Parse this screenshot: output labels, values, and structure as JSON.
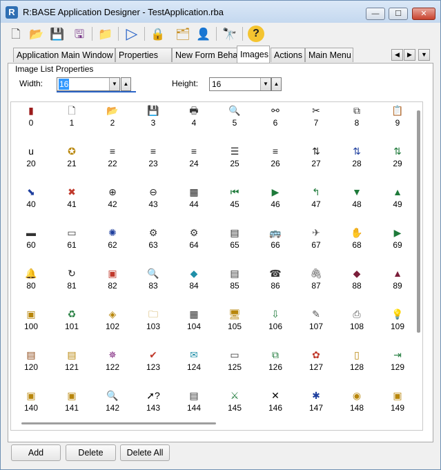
{
  "window": {
    "title": "R:BASE Application Designer - TestApplication.rba"
  },
  "window_controls": {
    "minimize": "—",
    "maximize": "☐",
    "close": "✕"
  },
  "toolbar": {
    "buttons": [
      {
        "name": "new-icon",
        "glyph": "🗋"
      },
      {
        "name": "open-folder-icon",
        "glyph": "📂"
      },
      {
        "name": "save-icon",
        "glyph": "💾"
      },
      {
        "name": "save-as-icon",
        "glyph": "🖫"
      },
      {
        "name": "folder-up-icon",
        "glyph": "📁"
      },
      {
        "name": "run-icon",
        "glyph": "▷"
      },
      {
        "name": "lock-icon",
        "glyph": "🔒"
      },
      {
        "name": "tree-icon",
        "glyph": "🗂"
      },
      {
        "name": "user-icon",
        "glyph": "👤"
      },
      {
        "name": "binoculars-icon",
        "glyph": "🔭"
      },
      {
        "name": "help-icon",
        "glyph": "?"
      }
    ]
  },
  "tabs": [
    {
      "label": "Application Main Window"
    },
    {
      "label": "Properties"
    },
    {
      "label": "New Form Behavior"
    },
    {
      "label": "Images"
    },
    {
      "label": "Actions"
    },
    {
      "label": "Main Menu"
    }
  ],
  "tab_scroll": {
    "left": "◀",
    "right": "▶",
    "menu": "▼"
  },
  "image_list_properties": {
    "title": "Image List Properties",
    "width_label": "Width:",
    "width_value": "16",
    "height_label": "Height:",
    "height_value": "16",
    "drop_glyph": "▼",
    "spin_glyph": "▲"
  },
  "images": [
    {
      "id": "0",
      "glyph": "▮",
      "color": "#9b1b1b"
    },
    {
      "id": "1",
      "glyph": "🗋",
      "color": "#333333"
    },
    {
      "id": "2",
      "glyph": "📂",
      "color": "#b8860b"
    },
    {
      "id": "3",
      "glyph": "💾",
      "color": "#333333"
    },
    {
      "id": "4",
      "glyph": "🖶",
      "color": "#333333"
    },
    {
      "id": "5",
      "glyph": "🔍",
      "color": "#333333"
    },
    {
      "id": "6",
      "glyph": "⚯",
      "color": "#222222"
    },
    {
      "id": "7",
      "glyph": "✂",
      "color": "#222222"
    },
    {
      "id": "8",
      "glyph": "⧉",
      "color": "#333333"
    },
    {
      "id": "9",
      "glyph": "📋",
      "color": "#333333"
    },
    {
      "id": "20",
      "glyph": "u",
      "color": "#000000"
    },
    {
      "id": "21",
      "glyph": "✪",
      "color": "#b8860b"
    },
    {
      "id": "22",
      "glyph": "≡",
      "color": "#222222"
    },
    {
      "id": "23",
      "glyph": "≡",
      "color": "#222222"
    },
    {
      "id": "24",
      "glyph": "≡",
      "color": "#222222"
    },
    {
      "id": "25",
      "glyph": "☰",
      "color": "#222222"
    },
    {
      "id": "26",
      "glyph": "≡",
      "color": "#222222"
    },
    {
      "id": "27",
      "glyph": "⇅",
      "color": "#222222"
    },
    {
      "id": "28",
      "glyph": "⇅",
      "color": "#1f3f9e"
    },
    {
      "id": "29",
      "glyph": "⇅",
      "color": "#1e7a3a"
    },
    {
      "id": "40",
      "glyph": "⬊",
      "color": "#1f3f9e"
    },
    {
      "id": "41",
      "glyph": "✖",
      "color": "#c0392b"
    },
    {
      "id": "42",
      "glyph": "⊕",
      "color": "#222222"
    },
    {
      "id": "43",
      "glyph": "⊖",
      "color": "#222222"
    },
    {
      "id": "44",
      "glyph": "▦",
      "color": "#222222"
    },
    {
      "id": "45",
      "glyph": "⏮",
      "color": "#1e7a3a"
    },
    {
      "id": "46",
      "glyph": "▶",
      "color": "#1e7a3a"
    },
    {
      "id": "47",
      "glyph": "↰",
      "color": "#1e7a3a"
    },
    {
      "id": "48",
      "glyph": "▼",
      "color": "#1e7a3a"
    },
    {
      "id": "49",
      "glyph": "▲",
      "color": "#1e7a3a"
    },
    {
      "id": "60",
      "glyph": "▬",
      "color": "#333333"
    },
    {
      "id": "61",
      "glyph": "▭",
      "color": "#333333"
    },
    {
      "id": "62",
      "glyph": "✺",
      "color": "#1f3f9e"
    },
    {
      "id": "63",
      "glyph": "⚙",
      "color": "#333333"
    },
    {
      "id": "64",
      "glyph": "⚙",
      "color": "#333333"
    },
    {
      "id": "65",
      "glyph": "▤",
      "color": "#222222"
    },
    {
      "id": "66",
      "glyph": "🚌",
      "color": "#1e7a3a"
    },
    {
      "id": "67",
      "glyph": "✈",
      "color": "#555555"
    },
    {
      "id": "68",
      "glyph": "✋",
      "color": "#555555"
    },
    {
      "id": "69",
      "glyph": "▶",
      "color": "#1e7a3a"
    },
    {
      "id": "80",
      "glyph": "🔔",
      "color": "#b8860b"
    },
    {
      "id": "81",
      "glyph": "↻",
      "color": "#222222"
    },
    {
      "id": "82",
      "glyph": "▣",
      "color": "#c0392b"
    },
    {
      "id": "83",
      "glyph": "🔍",
      "color": "#1f6fa8"
    },
    {
      "id": "84",
      "glyph": "◆",
      "color": "#1f8fa8"
    },
    {
      "id": "85",
      "glyph": "▤",
      "color": "#333333"
    },
    {
      "id": "86",
      "glyph": "☎",
      "color": "#333333"
    },
    {
      "id": "87",
      "glyph": "🖇",
      "color": "#555555"
    },
    {
      "id": "88",
      "glyph": "◆",
      "color": "#7b1e3a"
    },
    {
      "id": "89",
      "glyph": "▲",
      "color": "#7b1e3a"
    },
    {
      "id": "100",
      "glyph": "▣",
      "color": "#b8860b"
    },
    {
      "id": "101",
      "glyph": "♻",
      "color": "#1e7a3a"
    },
    {
      "id": "102",
      "glyph": "◈",
      "color": "#b8860b"
    },
    {
      "id": "103",
      "glyph": "🗀",
      "color": "#b8860b"
    },
    {
      "id": "104",
      "glyph": "▦",
      "color": "#333333"
    },
    {
      "id": "105",
      "glyph": "🖥",
      "color": "#b8860b"
    },
    {
      "id": "106",
      "glyph": "⇩",
      "color": "#1e7a3a"
    },
    {
      "id": "107",
      "glyph": "✎",
      "color": "#555555"
    },
    {
      "id": "108",
      "glyph": "⎙",
      "color": "#555555"
    },
    {
      "id": "109",
      "glyph": "💡",
      "color": "#b8860b"
    },
    {
      "id": "120",
      "glyph": "▤",
      "color": "#8b4513"
    },
    {
      "id": "121",
      "glyph": "▤",
      "color": "#b8860b"
    },
    {
      "id": "122",
      "glyph": "✵",
      "color": "#7b1e7a"
    },
    {
      "id": "123",
      "glyph": "✔",
      "color": "#c0392b"
    },
    {
      "id": "124",
      "glyph": "✉",
      "color": "#1f8fa8"
    },
    {
      "id": "125",
      "glyph": "▭",
      "color": "#333333"
    },
    {
      "id": "126",
      "glyph": "⧉",
      "color": "#1e7a3a"
    },
    {
      "id": "127",
      "glyph": "✿",
      "color": "#c0392b"
    },
    {
      "id": "128",
      "glyph": "▯",
      "color": "#b8860b"
    },
    {
      "id": "129",
      "glyph": "⇥",
      "color": "#1e7a3a"
    },
    {
      "id": "140",
      "glyph": "▣",
      "color": "#b8860b"
    },
    {
      "id": "141",
      "glyph": "▣",
      "color": "#b8860b"
    },
    {
      "id": "142",
      "glyph": "🔍",
      "color": "#1e7a3a"
    },
    {
      "id": "143",
      "glyph": "➚?",
      "color": "#000000"
    },
    {
      "id": "144",
      "glyph": "▤",
      "color": "#333333"
    },
    {
      "id": "145",
      "glyph": "⚔",
      "color": "#1e7a3a"
    },
    {
      "id": "146",
      "glyph": "✕",
      "color": "#000000"
    },
    {
      "id": "147",
      "glyph": "✱",
      "color": "#1f3f9e"
    },
    {
      "id": "148",
      "glyph": "◉",
      "color": "#b8860b"
    },
    {
      "id": "149",
      "glyph": "▣",
      "color": "#b8860b"
    }
  ],
  "buttons": {
    "add": "Add",
    "delete": "Delete",
    "delete_all": "Delete All"
  }
}
